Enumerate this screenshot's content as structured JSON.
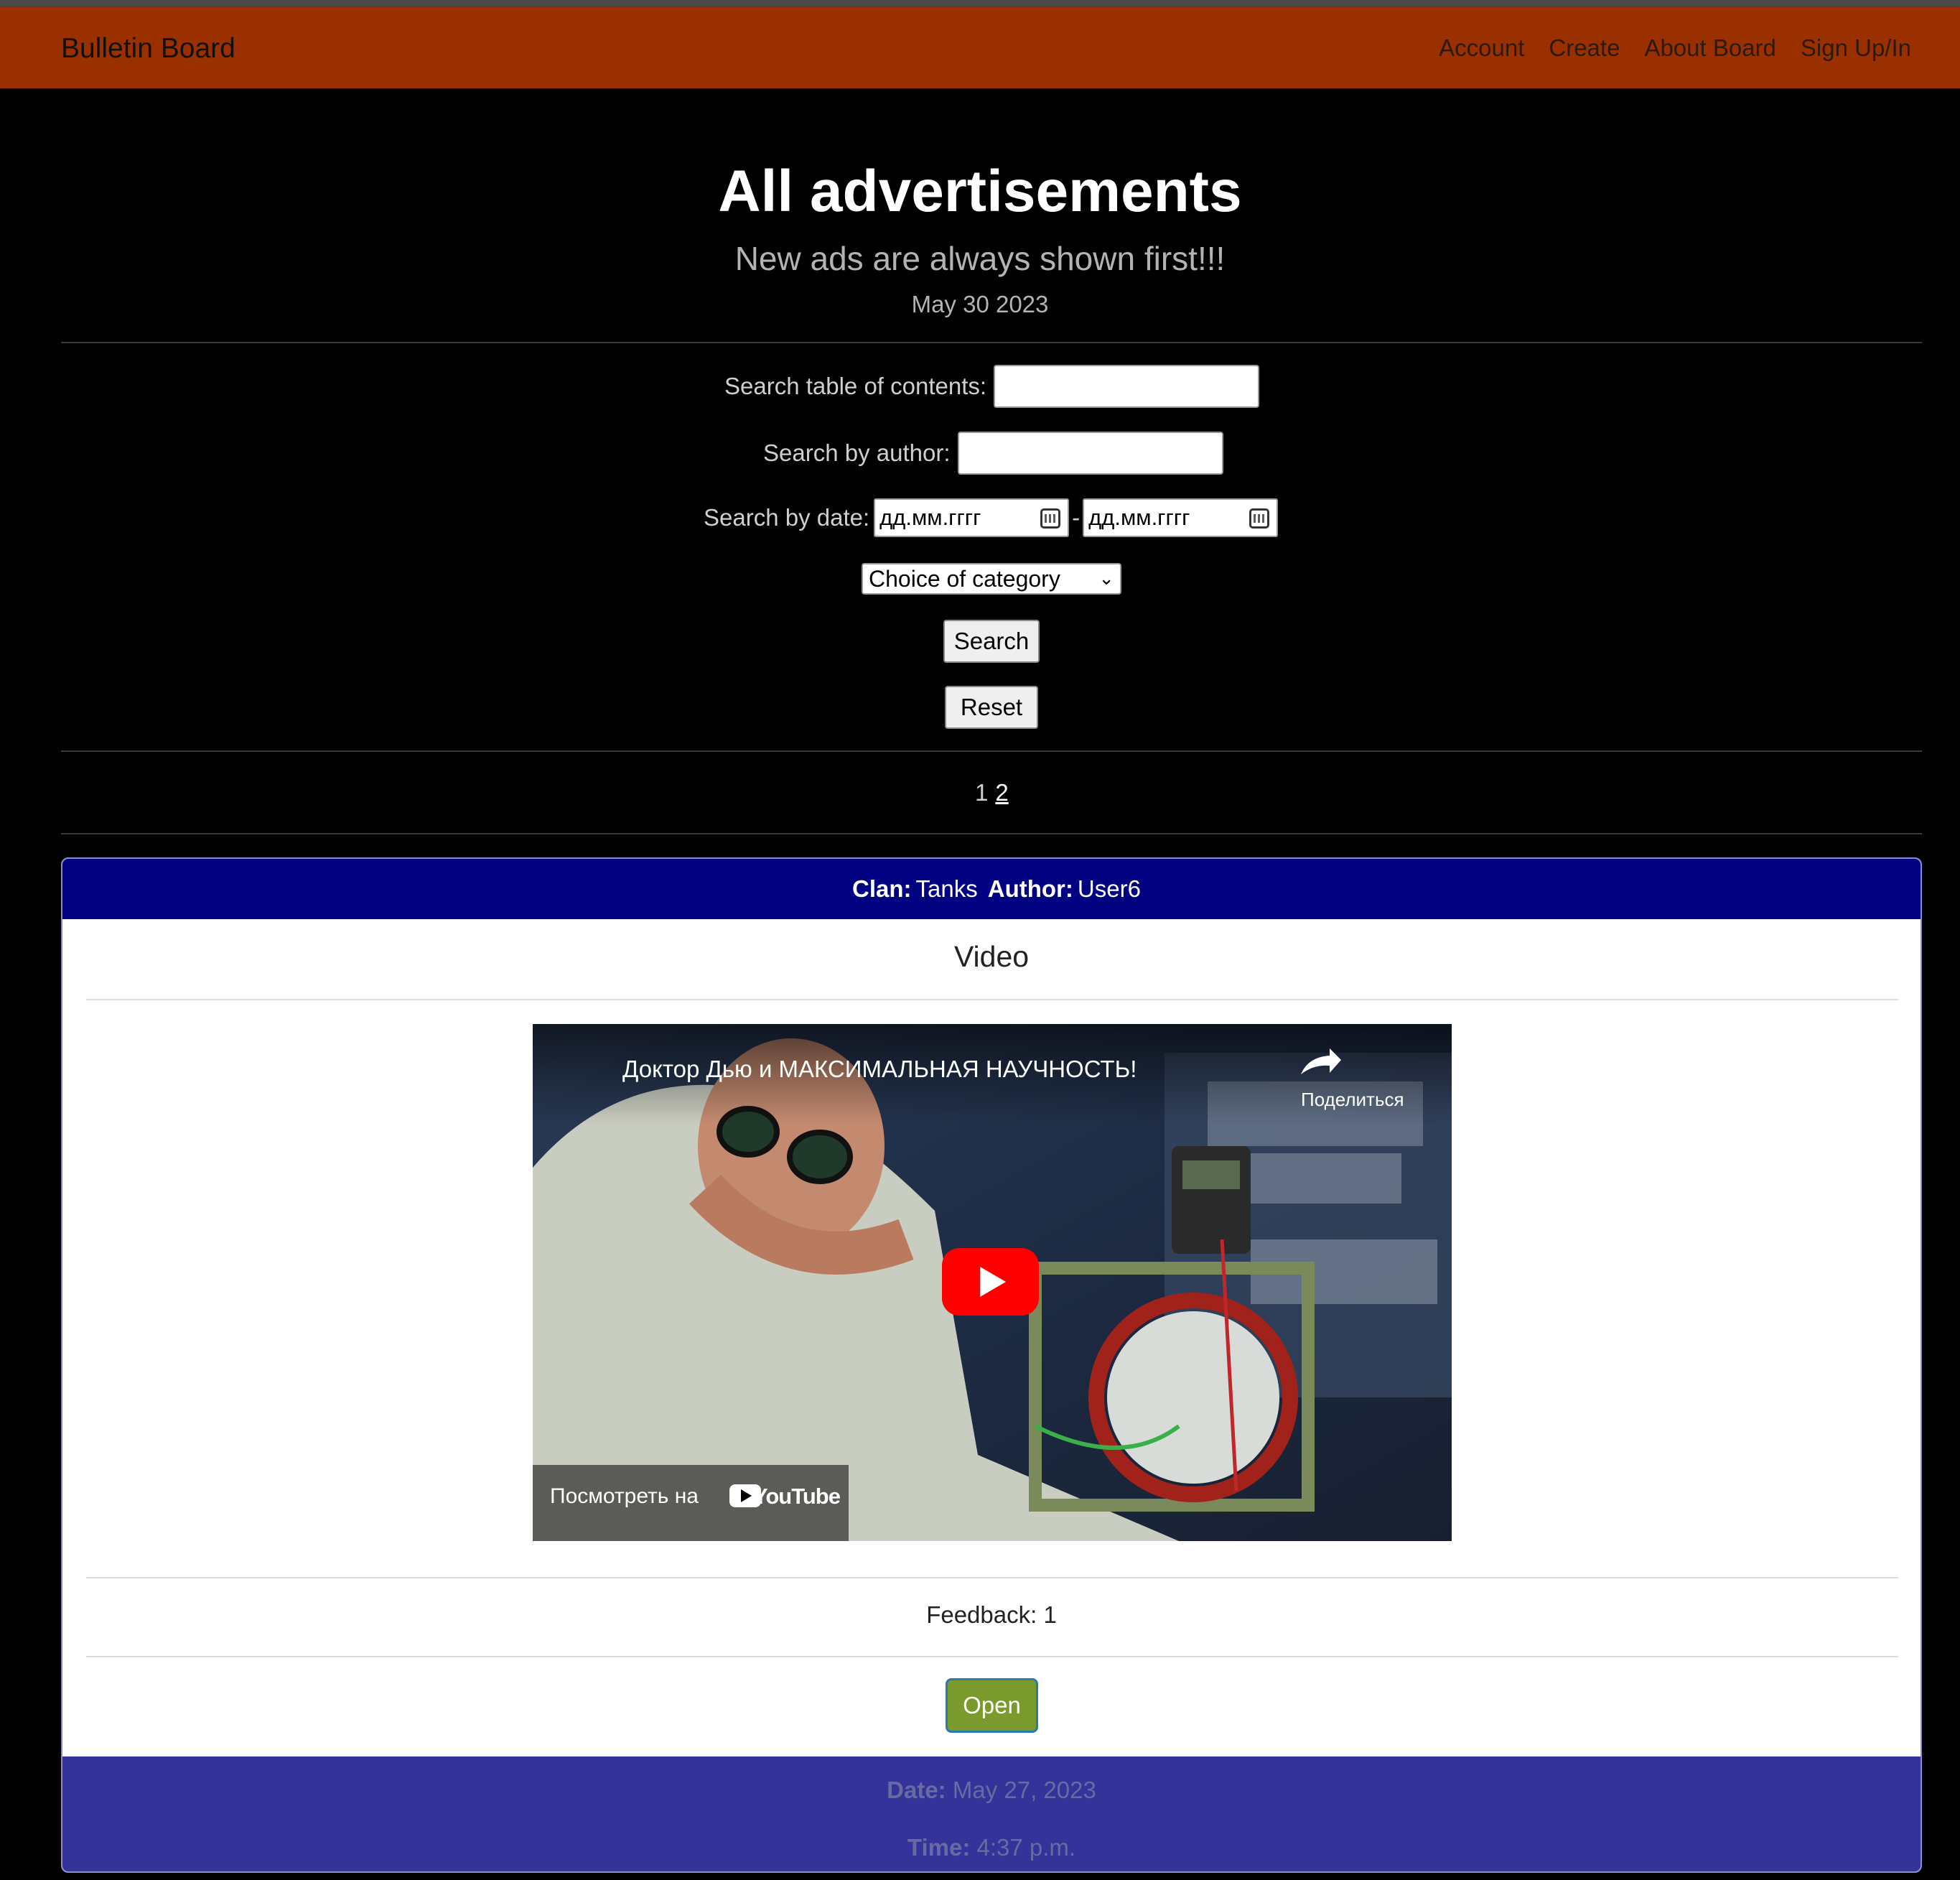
{
  "nav": {
    "brand": "Bulletin Board",
    "links": [
      "Account",
      "Create",
      "About Board",
      "Sign Up/In"
    ]
  },
  "header": {
    "title": "All advertisements",
    "subtitle": "New ads are always shown first!!!",
    "date": "May 30 2023"
  },
  "search": {
    "toc_label": "Search table of contents:",
    "author_label": "Search by author:",
    "date_label": "Search by date:",
    "date_from_placeholder": "дд.мм.гггг",
    "date_to_placeholder": "дд.мм.гггг",
    "date_separator": "-",
    "category_selected": "Choice of category",
    "search_button": "Search",
    "reset_button": "Reset"
  },
  "pagination": {
    "pages": [
      "1",
      "2"
    ]
  },
  "ad": {
    "clan_label": "Clan:",
    "clan": "Tanks",
    "author_label": "Author:",
    "author": "User6",
    "title": "Video",
    "video": {
      "title": "Доктор Дью и МАКСИМАЛЬНАЯ НАУЧНОСТЬ!",
      "share_label": "Поделиться",
      "watch_on": "Посмотреть на",
      "youtube_logo": "YouTube"
    },
    "feedback": "Feedback: 1",
    "open_button": "Open",
    "date_label": "Date:",
    "date": "May 27, 2023",
    "time_label": "Time:",
    "time": "4:37 p.m."
  }
}
